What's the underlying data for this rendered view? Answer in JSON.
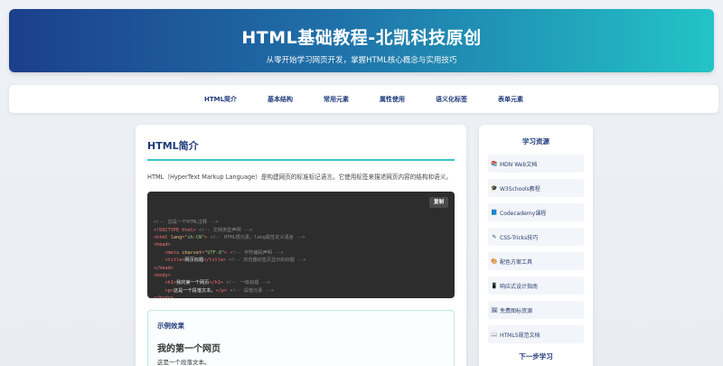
{
  "header": {
    "title": "HTML基础教程-北凯科技原创",
    "subtitle": "从零开始学习网页开发，掌握HTML核心概念与实用技巧"
  },
  "nav": {
    "items": [
      {
        "label": "HTML简介"
      },
      {
        "label": "基本结构"
      },
      {
        "label": "常用元素"
      },
      {
        "label": "属性使用"
      },
      {
        "label": "语义化标签"
      },
      {
        "label": "表单元素"
      }
    ]
  },
  "main": {
    "section_title": "HTML简介",
    "intro": "HTML（HyperText Markup Language）是构建网页的标准标记语言。它使用标签来描述网页内容的结构和语义。",
    "copy_label": "复制",
    "code_lines": [
      "<!-- 这是一个HTML注释 -->",
      "<!DOCTYPE html> <!-- 文档类型声明 -->",
      "<html lang=\"zh-CN\"> <!-- HTML根元素，lang属性定义语言 -->",
      "<head>",
      "    <meta charset=\"UTF-8\"> <!-- 字符编码声明 -->",
      "    <title>网页标题</title> <!-- 浏览器标签页显示的标题 -->",
      "</head>",
      "<body>",
      "    <h1>我的第一个网页</h1> <!-- 一级标题 -->",
      "    <p>这是一个段落文本。</p> <!-- 段落元素 -->",
      "</body>",
      "</html>"
    ],
    "example": {
      "label": "示例效果",
      "heading": "我的第一个网页",
      "paragraph": "这是一个段落文本。"
    }
  },
  "sidebar": {
    "title": "学习资源",
    "items": [
      {
        "icon": "📚",
        "icon_name": "books-icon",
        "label": "MDN Web文档"
      },
      {
        "icon": "🎓",
        "icon_name": "graduation-cap-icon",
        "label": "W3Schools教程"
      },
      {
        "icon": "📘",
        "icon_name": "blue-book-icon",
        "label": "Codecademy课程"
      },
      {
        "icon": "✎",
        "icon_name": "pencil-icon",
        "label": "CSS-Tricks技巧"
      },
      {
        "icon": "🎨",
        "icon_name": "palette-icon",
        "label": "配色方案工具"
      },
      {
        "icon": "📱",
        "icon_name": "mobile-icon",
        "label": "响应式设计指南"
      },
      {
        "icon": "🖼",
        "icon_name": "image-icon",
        "label": "免费图标资源"
      },
      {
        "icon": "📖",
        "icon_name": "open-book-icon",
        "label": "HTML5规范文档"
      }
    ],
    "next_title": "下一步学习"
  }
}
